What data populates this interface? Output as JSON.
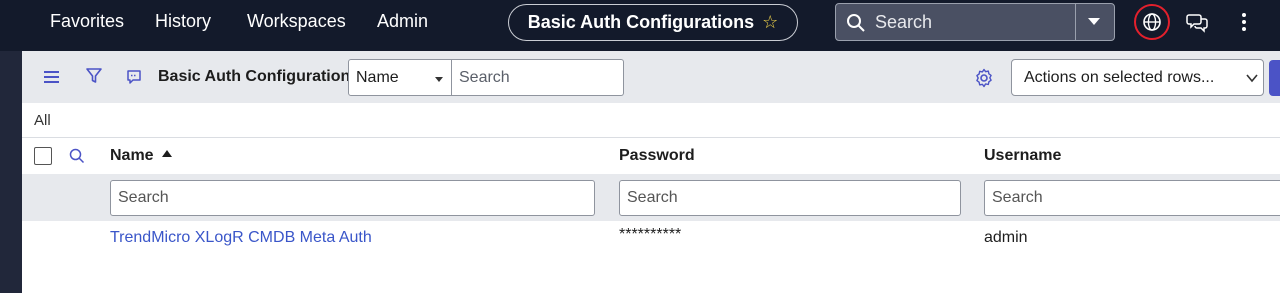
{
  "nav": {
    "items": [
      "Favorites",
      "History",
      "Workspaces",
      "Admin"
    ],
    "title": "Basic Auth Configurations",
    "search_placeholder": "Search"
  },
  "toolbar": {
    "title": "Basic Auth Configurations",
    "field_select": "Name",
    "search_placeholder": "Search",
    "actions_label": "Actions on selected rows..."
  },
  "breadcrumb": "All",
  "table": {
    "columns": [
      "Name",
      "Password",
      "Username"
    ],
    "filter_placeholder": "Search",
    "rows": [
      {
        "name": "TrendMicro XLogR CMDB Meta Auth",
        "password": "**********",
        "username": "admin"
      }
    ]
  },
  "colors": {
    "nav_bg": "#131a2b",
    "toolbar_bg": "#e7e9ed",
    "link": "#3a56c9",
    "accent": "#4b53c6",
    "highlight_ring": "#e3202c"
  }
}
